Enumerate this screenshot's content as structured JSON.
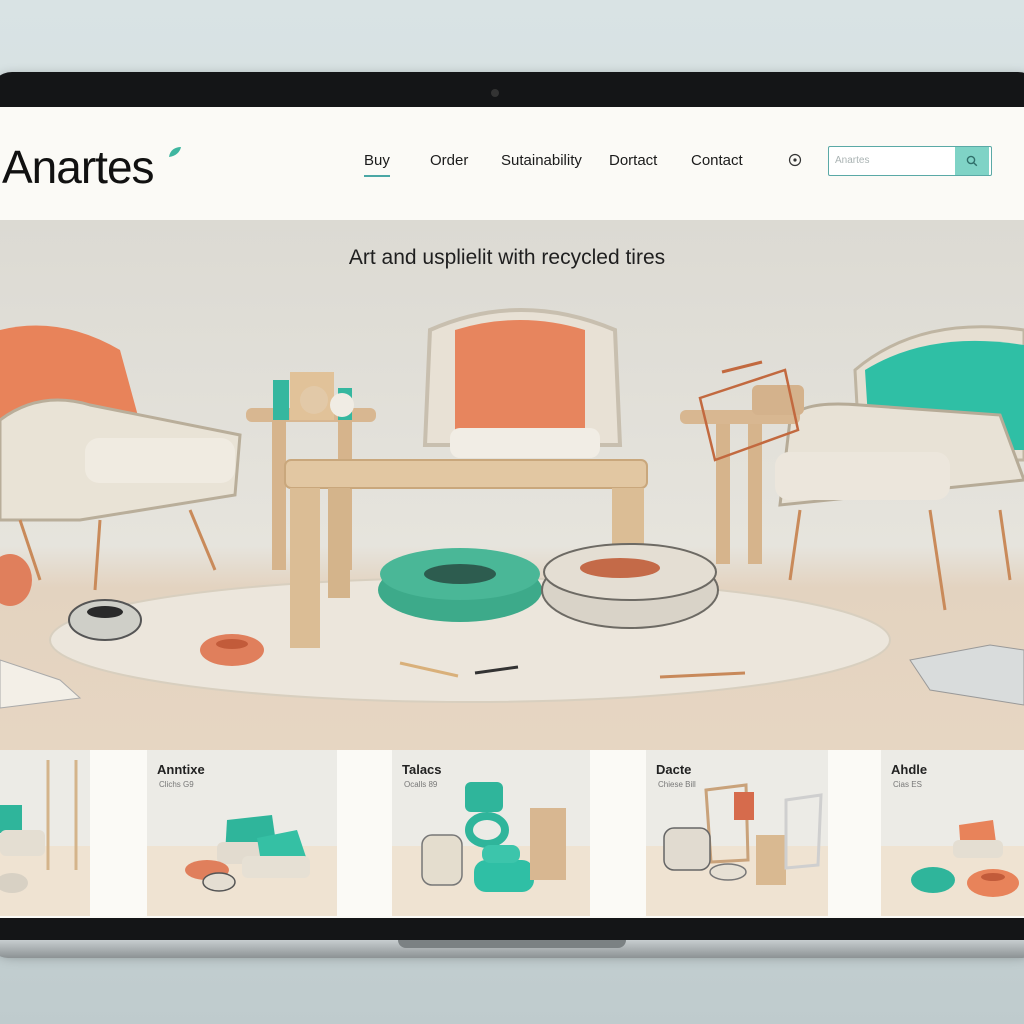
{
  "site": {
    "logo": "Anartes"
  },
  "nav": {
    "links": [
      "Buy",
      "Order",
      "Sutainability",
      "Dortact",
      "Contact"
    ],
    "active_index": 0,
    "search_placeholder": "Anartes"
  },
  "hero": {
    "title": "Art and usplielit with recycled tires"
  },
  "products": [
    {
      "title": "",
      "subtitle": ""
    },
    {
      "title": "Anntixe",
      "subtitle": "Clichs G9"
    },
    {
      "title": "Talacs",
      "subtitle": "Ocalls 89"
    },
    {
      "title": "Dacte",
      "subtitle": "Chiese Bill"
    },
    {
      "title": "Ahdle",
      "subtitle": "Cias ES"
    }
  ],
  "colors": {
    "accent": "#4aa7a5",
    "coral": "#e8835a",
    "teal": "#2fb59b",
    "bezel": "#141517"
  },
  "icons": [
    "leaf-icon",
    "globe-icon",
    "search-icon"
  ]
}
